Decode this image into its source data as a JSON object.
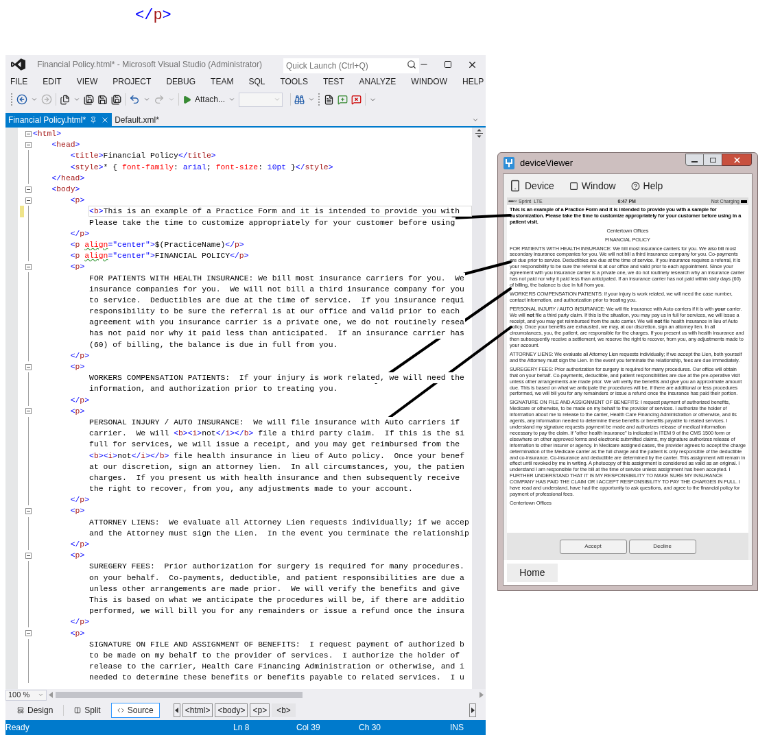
{
  "top_fragment": [
    {
      "kind": "tag",
      "text": "</p>"
    }
  ],
  "vs_window": {
    "title": "Financial Policy.html* - Microsoft Visual Studio (Administrator)",
    "quick_launch": {
      "placeholder": "Quick Launch (Ctrl+Q)"
    },
    "menu": [
      "FILE",
      "EDIT",
      "VIEW",
      "PROJECT",
      "DEBUG",
      "TEAM",
      "SQL",
      "TOOLS",
      "TEST",
      "ANALYZE",
      "WINDOW",
      "HELP"
    ],
    "toolbar": {
      "forward": {
        "disabled": true
      },
      "redo": {
        "disabled": true
      },
      "attach": "Attach..."
    },
    "tabs": [
      {
        "label": "Financial Policy.html*",
        "selected": true
      },
      {
        "label": "Default.xml*",
        "selected": false
      }
    ],
    "editor": {
      "lines": [
        {
          "fold": true,
          "changed": false,
          "current": false,
          "tokens": [
            {
              "kind": "tag",
              "text": "<html>"
            }
          ],
          "children": [
            {
              "fold": true,
              "changed": false,
              "current": false,
              "tokens": [
                {
                  "kind": "tag",
                  "text": "<head>"
                }
              ],
              "children": [
                {
                  "fold": false,
                  "changed": false,
                  "current": false,
                  "tokens": [
                    {
                      "kind": "tag",
                      "text": "<title>"
                    },
                    {
                      "kind": "text",
                      "text": "Financial Policy"
                    },
                    {
                      "kind": "tag",
                      "text": "</title>"
                    }
                  ]
                },
                {
                  "fold": false,
                  "changed": false,
                  "current": false,
                  "tokens": [
                    {
                      "kind": "tag",
                      "text": "<style>"
                    },
                    {
                      "kind": "text",
                      "text": "* { "
                    },
                    {
                      "kind": "prop",
                      "text": "font-family"
                    },
                    {
                      "kind": "text",
                      "text": ": "
                    },
                    {
                      "kind": "value",
                      "text": "arial"
                    },
                    {
                      "kind": "text",
                      "text": "; "
                    },
                    {
                      "kind": "prop",
                      "text": "font-size"
                    },
                    {
                      "kind": "text",
                      "text": ": "
                    },
                    {
                      "kind": "value",
                      "text": "10pt"
                    },
                    {
                      "kind": "text",
                      "text": " }"
                    },
                    {
                      "kind": "tag",
                      "text": "</style>"
                    }
                  ]
                }
              ]
            },
            {
              "fold": false,
              "changed": false,
              "current": false,
              "tokens": [
                {
                  "kind": "tag",
                  "text": "</head>"
                }
              ]
            },
            {
              "fold": true,
              "changed": false,
              "current": false,
              "tokens": [
                {
                  "kind": "tag",
                  "text": "<body>"
                }
              ],
              "children": [
                {
                  "fold": true,
                  "changed": false,
                  "current": false,
                  "tokens": [
                    {
                      "kind": "tag",
                      "text": "<p>"
                    }
                  ],
                  "children": [
                    {
                      "fold": false,
                      "changed": true,
                      "current": true,
                      "tokens": [
                        {
                          "kind": "tag",
                          "text": "<b>"
                        },
                        {
                          "kind": "text",
                          "text": "This is an example of a Practice Form and it is intended to provide you with"
                        }
                      ]
                    },
                    {
                      "fold": false,
                      "changed": false,
                      "current": false,
                      "tokens": [
                        {
                          "kind": "text",
                          "text": "Please take the time to customize appropriately for your customer before using"
                        }
                      ]
                    }
                  ]
                },
                {
                  "fold": false,
                  "changed": false,
                  "current": false,
                  "tokens": [
                    {
                      "kind": "tag",
                      "text": "</p>"
                    }
                  ]
                },
                {
                  "fold": false,
                  "changed": false,
                  "current": false,
                  "tokens": [
                    {
                      "kind": "tag",
                      "text": "<p "
                    },
                    {
                      "kind": "attr",
                      "text": "align"
                    },
                    {
                      "kind": "value",
                      "text": "=\"center\""
                    },
                    {
                      "kind": "tag",
                      "text": ">"
                    },
                    {
                      "kind": "text",
                      "text": "$(PracticeName)"
                    },
                    {
                      "kind": "tag",
                      "text": "</p>"
                    }
                  ]
                },
                {
                  "fold": false,
                  "changed": false,
                  "current": false,
                  "tokens": [
                    {
                      "kind": "tag",
                      "text": "<p "
                    },
                    {
                      "kind": "attr",
                      "text": "align"
                    },
                    {
                      "kind": "value",
                      "text": "=\"center\""
                    },
                    {
                      "kind": "tag",
                      "text": ">"
                    },
                    {
                      "kind": "text",
                      "text": "FINANCIAL POLICY"
                    },
                    {
                      "kind": "tag",
                      "text": "</p>"
                    }
                  ]
                },
                {
                  "fold": true,
                  "changed": false,
                  "current": false,
                  "tokens": [
                    {
                      "kind": "tag",
                      "text": "<p>"
                    }
                  ],
                  "children": [
                    {
                      "fold": false,
                      "changed": false,
                      "current": false,
                      "tokens": [
                        {
                          "kind": "text",
                          "text": "FOR PATIENTS WITH HEALTH INSURANCE: We bill most insurance carriers for you.  We"
                        }
                      ]
                    },
                    {
                      "fold": false,
                      "changed": false,
                      "current": false,
                      "tokens": [
                        {
                          "kind": "text",
                          "text": "insurance companies for you.  We will not bill a third insurance company for you"
                        }
                      ]
                    },
                    {
                      "fold": false,
                      "changed": false,
                      "current": false,
                      "tokens": [
                        {
                          "kind": "text",
                          "text": "to service.  Deductibles are due at the time of service.  If you insurance requi"
                        }
                      ]
                    },
                    {
                      "fold": false,
                      "changed": false,
                      "current": false,
                      "tokens": [
                        {
                          "kind": "text",
                          "text": "responsibility to be sure the referral is at our office and valid prior to each"
                        }
                      ]
                    },
                    {
                      "fold": false,
                      "changed": false,
                      "current": false,
                      "tokens": [
                        {
                          "kind": "text",
                          "text": "agreement with you insurance carrier is a private one, we do not routinely resea"
                        }
                      ]
                    },
                    {
                      "fold": false,
                      "changed": false,
                      "current": false,
                      "tokens": [
                        {
                          "kind": "text",
                          "text": "has not paid nor why it paid less than anticipated.  If an insurance carrier has"
                        }
                      ]
                    },
                    {
                      "fold": false,
                      "changed": false,
                      "current": false,
                      "tokens": [
                        {
                          "kind": "text",
                          "text": "(60) of billing, the balance is due in full from you."
                        }
                      ]
                    }
                  ]
                },
                {
                  "fold": false,
                  "changed": false,
                  "current": false,
                  "tokens": [
                    {
                      "kind": "tag",
                      "text": "</p>"
                    }
                  ]
                },
                {
                  "fold": true,
                  "changed": false,
                  "current": false,
                  "tokens": [
                    {
                      "kind": "tag",
                      "text": "<p>"
                    }
                  ],
                  "children": [
                    {
                      "fold": false,
                      "changed": false,
                      "current": false,
                      "tokens": [
                        {
                          "kind": "text",
                          "text": "WORKERS COMPENSATION PATIENTS:  If your injury is work related, we will need the"
                        }
                      ]
                    },
                    {
                      "fold": false,
                      "changed": false,
                      "current": false,
                      "tokens": [
                        {
                          "kind": "text",
                          "text": "information, and authorization prior to treating you."
                        }
                      ]
                    }
                  ]
                },
                {
                  "fold": false,
                  "changed": false,
                  "current": false,
                  "tokens": [
                    {
                      "kind": "tag",
                      "text": "</p>"
                    }
                  ]
                },
                {
                  "fold": true,
                  "changed": false,
                  "current": false,
                  "tokens": [
                    {
                      "kind": "tag",
                      "text": "<p>"
                    }
                  ],
                  "children": [
                    {
                      "fold": false,
                      "changed": false,
                      "current": false,
                      "tokens": [
                        {
                          "kind": "text",
                          "text": "PERSONAL INJURY / AUTO INSURANCE:  We will file insurance with Auto carriers if"
                        }
                      ]
                    },
                    {
                      "fold": false,
                      "changed": false,
                      "current": false,
                      "tokens": [
                        {
                          "kind": "text",
                          "text": "carrier.  We will "
                        },
                        {
                          "kind": "tag",
                          "text": "<b>"
                        },
                        {
                          "kind": "tag",
                          "text": "<i>"
                        },
                        {
                          "kind": "text",
                          "text": "not"
                        },
                        {
                          "kind": "tag",
                          "text": "</i>"
                        },
                        {
                          "kind": "tag",
                          "text": "</b>"
                        },
                        {
                          "kind": "text",
                          "text": " file a third party claim.  If this is the si"
                        }
                      ]
                    },
                    {
                      "fold": false,
                      "changed": false,
                      "current": false,
                      "tokens": [
                        {
                          "kind": "text",
                          "text": "full for services, we will issue a receipt, and you may get reimbursed from the"
                        }
                      ]
                    },
                    {
                      "fold": false,
                      "changed": false,
                      "current": false,
                      "tokens": [
                        {
                          "kind": "tag",
                          "text": "<b>"
                        },
                        {
                          "kind": "tag",
                          "text": "<i>"
                        },
                        {
                          "kind": "text",
                          "text": "not"
                        },
                        {
                          "kind": "tag",
                          "text": "</i>"
                        },
                        {
                          "kind": "tag",
                          "text": "</b>"
                        },
                        {
                          "kind": "text",
                          "text": " file health insurance in lieu of Auto policy.  Once your benef"
                        }
                      ]
                    },
                    {
                      "fold": false,
                      "changed": false,
                      "current": false,
                      "tokens": [
                        {
                          "kind": "text",
                          "text": "at our discretion, sign an attorney lien.  In all circumstances, you, the patien"
                        }
                      ]
                    },
                    {
                      "fold": false,
                      "changed": false,
                      "current": false,
                      "tokens": [
                        {
                          "kind": "text",
                          "text": "charges.  If you present us with health insurance and then subsequently receive"
                        }
                      ]
                    },
                    {
                      "fold": false,
                      "changed": false,
                      "current": false,
                      "tokens": [
                        {
                          "kind": "text",
                          "text": "the right to recover, from you, any adjustments made to your account."
                        }
                      ]
                    }
                  ]
                },
                {
                  "fold": false,
                  "changed": false,
                  "current": false,
                  "tokens": [
                    {
                      "kind": "tag",
                      "text": "</p>"
                    }
                  ]
                },
                {
                  "fold": true,
                  "changed": false,
                  "current": false,
                  "tokens": [
                    {
                      "kind": "tag",
                      "text": "<p>"
                    }
                  ],
                  "children": [
                    {
                      "fold": false,
                      "changed": false,
                      "current": false,
                      "tokens": [
                        {
                          "kind": "text",
                          "text": "ATTORNEY LIENS:  We evaluate all Attorney Lien requests individually; if we accep"
                        }
                      ]
                    },
                    {
                      "fold": false,
                      "changed": false,
                      "current": false,
                      "tokens": [
                        {
                          "kind": "text",
                          "text": "and the Attorney must sign the Lien.  In the event you terminate the relationship"
                        }
                      ]
                    }
                  ]
                },
                {
                  "fold": false,
                  "changed": false,
                  "current": false,
                  "tokens": [
                    {
                      "kind": "tag",
                      "text": "</p>"
                    }
                  ]
                },
                {
                  "fold": true,
                  "changed": false,
                  "current": false,
                  "tokens": [
                    {
                      "kind": "tag",
                      "text": "<p>"
                    }
                  ],
                  "children": [
                    {
                      "fold": false,
                      "changed": false,
                      "current": false,
                      "tokens": [
                        {
                          "kind": "text",
                          "text": "SUREGERY FEES:  Prior authorization for surgery is required for many procedures."
                        }
                      ]
                    },
                    {
                      "fold": false,
                      "changed": false,
                      "current": false,
                      "tokens": [
                        {
                          "kind": "text",
                          "text": "on your behalf.  Co-payments, deductible, and patient responsibilities are due a"
                        }
                      ]
                    },
                    {
                      "fold": false,
                      "changed": false,
                      "current": false,
                      "tokens": [
                        {
                          "kind": "text",
                          "text": "unless other arrangements are made prior.  We will verify the benefits and give"
                        }
                      ]
                    },
                    {
                      "fold": false,
                      "changed": false,
                      "current": false,
                      "tokens": [
                        {
                          "kind": "text",
                          "text": "This is based on what we anticipate the procedures will be, if there are additio"
                        }
                      ]
                    },
                    {
                      "fold": false,
                      "changed": false,
                      "current": false,
                      "tokens": [
                        {
                          "kind": "text",
                          "text": "performed, we will bill you for any remainders or issue a refund once the insura"
                        }
                      ]
                    }
                  ]
                },
                {
                  "fold": false,
                  "changed": false,
                  "current": false,
                  "tokens": [
                    {
                      "kind": "tag",
                      "text": "</p>"
                    }
                  ]
                },
                {
                  "fold": true,
                  "changed": false,
                  "current": false,
                  "tokens": [
                    {
                      "kind": "tag",
                      "text": "<p>"
                    }
                  ],
                  "children": [
                    {
                      "fold": false,
                      "changed": false,
                      "current": false,
                      "tokens": [
                        {
                          "kind": "text",
                          "text": "SIGNATURE ON FILE AND ASSIGNMENT OF BENEFITS:  I request payment of authorized b"
                        }
                      ]
                    },
                    {
                      "fold": false,
                      "changed": false,
                      "current": false,
                      "tokens": [
                        {
                          "kind": "text",
                          "text": "to be made on my behalf to the provider of services.  I authorize the holder of"
                        }
                      ]
                    },
                    {
                      "fold": false,
                      "changed": false,
                      "current": false,
                      "tokens": [
                        {
                          "kind": "text",
                          "text": "release to the carrier, Health Care Financing Administration or otherwise, and i"
                        }
                      ]
                    },
                    {
                      "fold": false,
                      "changed": false,
                      "current": false,
                      "tokens": [
                        {
                          "kind": "text",
                          "text": "needed to determine these benefits or benefits payable to related services.  I u"
                        }
                      ]
                    }
                  ]
                }
              ]
            }
          ]
        }
      ]
    },
    "zoom": "100 %",
    "view_buttons": [
      {
        "label": "Design",
        "selected": false
      },
      {
        "label": "Split",
        "selected": false
      },
      {
        "label": "Source",
        "selected": true
      }
    ],
    "breadcrumb": [
      {
        "label": "<html>",
        "selected": false
      },
      {
        "label": "<body>",
        "selected": false
      },
      {
        "label": "<p>",
        "selected": false
      },
      {
        "label": "<b>",
        "selected": true
      }
    ],
    "status_bar": {
      "state": "Ready",
      "line": "Ln 8",
      "column": "Col 39",
      "char": "Ch 30",
      "mode": "INS"
    }
  },
  "device_viewer": {
    "title": "deviceViewer",
    "menu": [
      {
        "kind": "phone",
        "label": "Device"
      },
      {
        "kind": "window",
        "label": "Window"
      },
      {
        "kind": "help",
        "label": "Help"
      }
    ],
    "phone_status": {
      "carrier": "Sprint",
      "network": "LTE",
      "time": "6:47 PM",
      "battery": "Not Charging"
    },
    "paragraphs": [
      {
        "kind": "bold",
        "text": "This is an example of a Practice Form and it is intended to provide you with a sample for customization. Please take the time to customize appropriately for your customer before using in a patient visit."
      },
      {
        "kind": "center",
        "text": "Centertown Offices"
      },
      {
        "kind": "center",
        "text": "FINANCIAL POLICY"
      },
      {
        "kind": "normal",
        "text": "FOR PATIENTS WITH HEALTH INSURANCE: We bill most insurance carriers for you. We also bill most secondary insurance companies for you. We will not bill a third insurance company for you. Co-payments are due prior to service. Deductibles are due at the time of service. If you insurance requires a referral, it is your responsibility to be sure the referral is at our office and valid prior to each appointment. Since your agreement with you insurance carrier is a private one, we do not routinely research why an insurance carrier has not paid nor why it paid less than anticipated. If an insurance carrier has not paid within sixty days (60) of billing, the balance is due in full from you."
      },
      {
        "kind": "normal",
        "text": "WORKERS COMPENSATION PATIENTS: If your injury is work related, we will need the case number, contact information, and authorization prior to treating you."
      },
      {
        "kind": "normal",
        "text": "PERSONAL INJURY / AUTO INSURANCE: We will file insurance with Auto carriers if it is with **your** carrier. We will **not** file a third party claim. If this is the situation, you may pay us in full for services, we will issue a receipt, and you may get reimbursed from the auto carrier. We will **not** file health insurance in lieu of Auto policy. Once your benefits are exhausted, we may, at our discretion, sign an attorney lien. In all circumstances, you, the patient, are responsible for the charges. If you present us with health insurance and then subsequently receive a settlement, we reserve the right to recover, from you, any adjustments made to your account."
      },
      {
        "kind": "normal",
        "text": "ATTORNEY LIENS: We evaluate all Attorney Lien requests individually; if we accept the Lien, both yourself and the Attorney must sign the Lien. In the event you terminate the relationship, fees are due immediately."
      },
      {
        "kind": "normal",
        "text": "SUREGERY FEES: Prior authorization for surgery is required for many procedures. Our office will obtain that on your behalf. Co-payments, deductible, and patient responsibilities are due at the pre-operative visit unless other arrangements are made prior. We will verify the benefits and give you an approximate amount due. This is based on what we anticipate the procedures will be, if there are additional or less procedures performed, we will bill you for any remainders or issue a refund once the insurance has paid their portion."
      },
      {
        "kind": "normal",
        "text": "SIGNATURE ON FILE AND ASSIGNMENT OF BENEFITS: I request payment of authorized benefits, Medicare or otherwise, to be made on my behalf to the provider of services. I authorize the holder of information about me to release to the carrier, Health Care Financing Administration or otherwise, and its agents, any information needed to determine these benefits or benefits payable to related services. I understand my signature requests payment be made and authorizes release of medical information necessary to pay the claim. If \"other health insurance\" is indicated in ITEM 9 of the CMS 1500 form or elsewhere on other approved forms and electronic submitted claims, my signature authorizes release of information to other insurer or agency. In Medicare assigned cases, the provider agrees to accept the charge determination of the Medicare carrier as the full charge and the patient is only responsible of the deductible and co-insurance. Co-insurance and deductible are determined by the carrier. This assignment will remain in effect until revoked by me in writing. A photocopy of this assignment is considered as valid as an original. I understand I am responsible for the bill at the time of service unless assignment has been accepted. I FURTHER UNDERSTAND THAT IT IS MY RESPONSIBILITY TO MAKE SURE MY INSURANCE COMPANY HAS PAID THE CLAIM OR I ACCEPT RESPONSIBILITY TO PAY THE CHARGES IN FULL. I have read and understand, have had the opportunity to ask questions, and agree to the financial policy for payment of professional fees."
      },
      {
        "kind": "normal",
        "text": "Centertown Offices"
      }
    ],
    "buttons": [
      "Accept",
      "Decline"
    ],
    "home": "Home"
  }
}
